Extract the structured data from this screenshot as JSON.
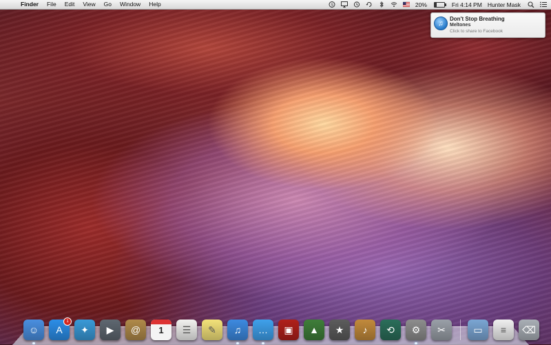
{
  "menubar": {
    "apple_glyph": "",
    "items": [
      "Finder",
      "File",
      "Edit",
      "View",
      "Go",
      "Window",
      "Help"
    ],
    "battery_percent": "20%",
    "battery_level": 0.2,
    "clock": "Fri 4:14 PM",
    "user": "Hunter Mask",
    "status_icons": [
      "skype-icon",
      "airplay-icon",
      "time-machine-icon",
      "sync-icon",
      "bluetooth-icon",
      "wifi-icon",
      "flag-icon"
    ]
  },
  "notification": {
    "title": "Don't Stop Breathing",
    "subtitle": "Meltones",
    "info": "Click to share to Facebook",
    "icon": "itunes-note-icon"
  },
  "dock": {
    "apps": [
      {
        "name": "finder",
        "icon": "finder-icon",
        "color": "#4a8fe0"
      },
      {
        "name": "app-store",
        "icon": "app-store-icon",
        "color": "#2c8ee8",
        "badge": "1"
      },
      {
        "name": "safari",
        "icon": "safari-icon",
        "color": "#3a9ad8"
      },
      {
        "name": "facetime",
        "icon": "facetime-icon",
        "color": "#5e6770"
      },
      {
        "name": "contacts",
        "icon": "contacts-icon",
        "color": "#b08a4a"
      },
      {
        "name": "calendar",
        "icon": "calendar-icon",
        "color": "#f4f4f4",
        "text": "1"
      },
      {
        "name": "reminders",
        "icon": "reminders-icon",
        "color": "#f2f2f0"
      },
      {
        "name": "notes",
        "icon": "notes-icon",
        "color": "#f3e27a"
      },
      {
        "name": "itunes",
        "icon": "itunes-icon",
        "color": "#3d8ae0"
      },
      {
        "name": "messages",
        "icon": "messages-icon",
        "color": "#3fa1ec"
      },
      {
        "name": "photo-booth",
        "icon": "photo-booth-icon",
        "color": "#b0201a"
      },
      {
        "name": "iphoto",
        "icon": "iphoto-icon",
        "color": "#3f7e3a"
      },
      {
        "name": "imovie",
        "icon": "imovie-icon",
        "color": "#5c5c5c"
      },
      {
        "name": "garageband",
        "icon": "garageband-icon",
        "color": "#c28a3c"
      },
      {
        "name": "time-machine",
        "icon": "time-machine-app-icon",
        "color": "#2b6e5a"
      },
      {
        "name": "system-preferences",
        "icon": "system-preferences-icon",
        "color": "#8d8d8d"
      },
      {
        "name": "utilities",
        "icon": "utilities-icon",
        "color": "#9aa0a8"
      }
    ],
    "folders": [
      {
        "name": "applications-folder",
        "icon": "folder-icon",
        "color": "#7ba6d4"
      },
      {
        "name": "documents",
        "icon": "document-icon",
        "color": "#f0f0f0"
      },
      {
        "name": "trash",
        "icon": "trash-icon",
        "color": "#a9afb6"
      }
    ]
  }
}
